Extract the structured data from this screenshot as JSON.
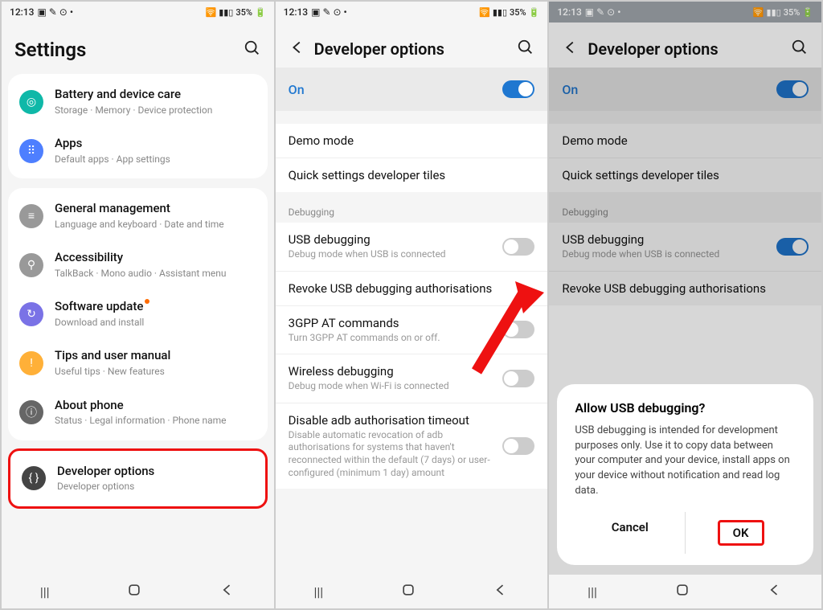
{
  "status": {
    "time": "12:13",
    "battery": "35%"
  },
  "screen1": {
    "title": "Settings",
    "items": [
      {
        "title": "Battery and device care",
        "sub": "Storage · Memory · Device protection"
      },
      {
        "title": "Apps",
        "sub": "Default apps · App settings"
      },
      {
        "title": "General management",
        "sub": "Language and keyboard · Date and time"
      },
      {
        "title": "Accessibility",
        "sub": "TalkBack · Mono audio · Assistant menu"
      },
      {
        "title": "Software update",
        "sub": "Download and install"
      },
      {
        "title": "Tips and user manual",
        "sub": "Useful tips · New features"
      },
      {
        "title": "About phone",
        "sub": "Status · Legal information · Phone name"
      },
      {
        "title": "Developer options",
        "sub": "Developer options"
      }
    ]
  },
  "devopts": {
    "title": "Developer options",
    "master_label": "On",
    "rows": {
      "demo": "Demo mode",
      "quick": "Quick settings developer tiles",
      "section_debug": "Debugging",
      "usb_title": "USB debugging",
      "usb_sub": "Debug mode when USB is connected",
      "revoke": "Revoke USB debugging authorisations",
      "gpp_title": "3GPP AT commands",
      "gpp_sub": "Turn 3GPP AT commands on or off.",
      "wireless_title": "Wireless debugging",
      "wireless_sub": "Debug mode when Wi-Fi is connected",
      "disable_title": "Disable adb authorisation timeout",
      "disable_sub": "Disable automatic revocation of adb authorisations for systems that haven't reconnected within the default (7 days) or user-configured (minimum 1 day) amount",
      "disable_sub_short": "user-configured (minimum 1 day) amount"
    }
  },
  "dialog": {
    "title": "Allow USB debugging?",
    "body": "USB debugging is intended for development purposes only. Use it to copy data between your computer and your device, install apps on your device without notification and read log data.",
    "cancel": "Cancel",
    "ok": "OK"
  }
}
